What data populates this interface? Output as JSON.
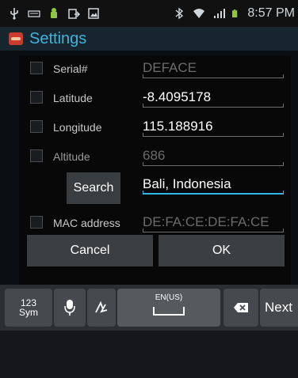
{
  "status_bar": {
    "time": "8:57 PM",
    "icons": [
      "usb-icon",
      "keyboard-notification-icon",
      "android-icon",
      "download-icon",
      "image-icon",
      "bluetooth-icon",
      "wifi-icon",
      "signal-icon",
      "battery-icon"
    ]
  },
  "header": {
    "title": "Settings"
  },
  "dialog": {
    "rows": [
      {
        "label": "Serial#",
        "value": "DEFACE",
        "value_dim": true
      },
      {
        "label": "Latitude",
        "value": "-8.4095178",
        "value_dim": false
      },
      {
        "label": "Longitude",
        "value": "115.188916",
        "value_dim": false
      },
      {
        "label": "Altitude",
        "value": "686",
        "value_dim": true
      },
      {
        "label": "MAC address",
        "value": "DE:FA:CE:DE:FA:CE",
        "value_dim": true
      }
    ],
    "search_button": "Search",
    "location_value": "Bali, Indonesia",
    "cancel_label": "Cancel",
    "ok_label": "OK"
  },
  "keyboard": {
    "sym_key": "123\nSym",
    "sym_key_top": "123",
    "sym_key_bottom": "Sym",
    "language": "EN(US)",
    "next_label": "Next"
  },
  "colors": {
    "accent": "#32b5e5",
    "title": "#3fb3de"
  }
}
